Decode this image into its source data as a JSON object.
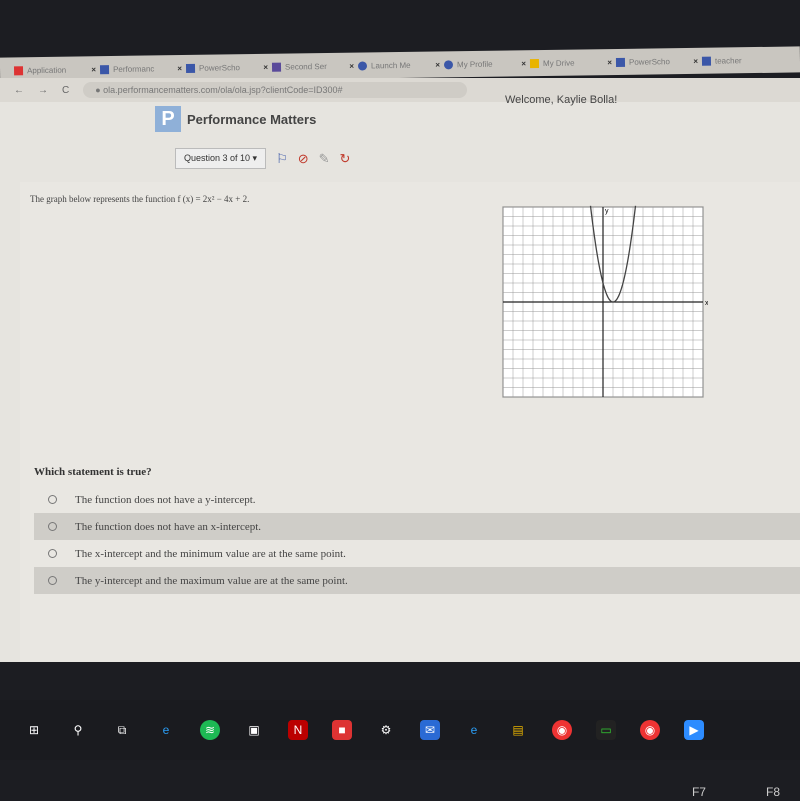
{
  "browser": {
    "tabs": [
      {
        "label": "Application"
      },
      {
        "label": "Performanc"
      },
      {
        "label": "PowerScho"
      },
      {
        "label": "Second Ser"
      },
      {
        "label": "Launch Me"
      },
      {
        "label": "My Profile"
      },
      {
        "label": "My Drive"
      },
      {
        "label": "PowerScho"
      },
      {
        "label": "teacher"
      }
    ],
    "url": "ola.performancematters.com/ola/ola.jsp?clientCode=ID300#"
  },
  "header": {
    "brand": "Performance Matters",
    "logo_letter": "P",
    "welcome": "Welcome, Kaylie Bolla!"
  },
  "question_nav": {
    "selector": "Question 3 of 10 ▾",
    "icons": [
      "flag-icon",
      "no-entry-icon",
      "pencil-icon",
      "refresh-icon"
    ]
  },
  "question": {
    "prompt": "The graph below represents the function f (x) = 2x² − 4x + 2.",
    "graph": {
      "function": "2x^2-4x+2",
      "xlim": [
        -10,
        10
      ],
      "ylim": [
        -10,
        10
      ],
      "grid": true,
      "vertex": [
        1,
        0
      ],
      "x_axis_label": "x",
      "y_axis_label": "y"
    },
    "stem": "Which statement is true?",
    "options": [
      {
        "label": "The function does not have a y-intercept.",
        "selected": false
      },
      {
        "label": "The function does not have an x-intercept.",
        "selected": true
      },
      {
        "label": "The x-intercept and the minimum value are at the same point.",
        "selected": false
      },
      {
        "label": "The y-intercept and the maximum value are at the same point.",
        "selected": false
      }
    ]
  },
  "keyboard": {
    "keys": [
      "F7",
      "F8"
    ]
  }
}
